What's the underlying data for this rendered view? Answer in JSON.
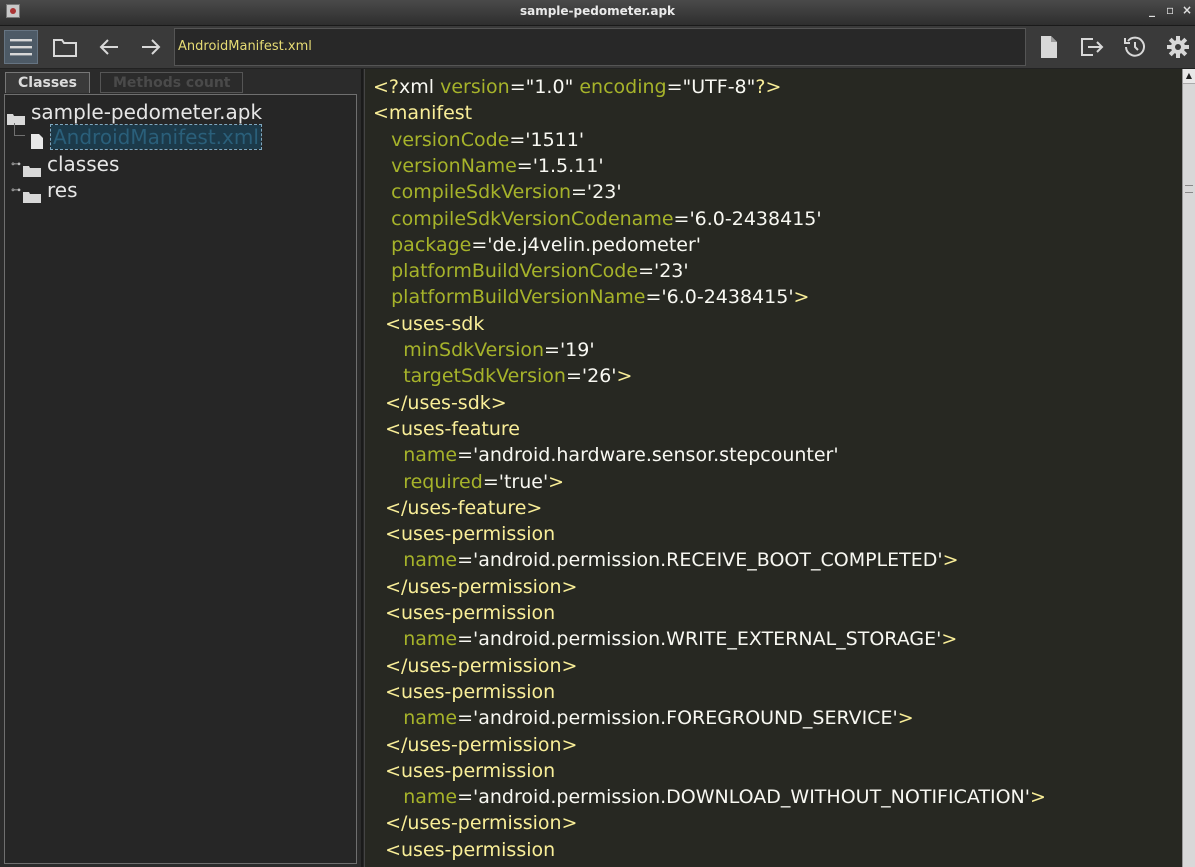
{
  "window": {
    "title": "sample-pedometer.apk",
    "controls": {
      "minimize": "_",
      "maximize": "▫",
      "close": "×"
    }
  },
  "toolbar": {
    "menu_icon": "hamburger-menu-icon",
    "path": "AndroidManifest.xml",
    "icons": [
      "open-folder-icon",
      "back-arrow-icon",
      "forward-arrow-icon",
      "file-icon",
      "export-icon",
      "history-icon",
      "gear-icon"
    ]
  },
  "tabs": {
    "classes": "Classes",
    "methods_count": "Methods count"
  },
  "tree": {
    "root": "sample-pedometer.apk",
    "items": [
      {
        "label": "AndroidManifest.xml",
        "icon": "file-icon",
        "selected": true
      },
      {
        "label": "classes",
        "icon": "folder-icon",
        "expandable": true
      },
      {
        "label": "res",
        "icon": "folder-icon",
        "expandable": true
      }
    ]
  },
  "editor": {
    "lines": [
      [
        [
          "pi",
          "<?"
        ],
        [
          "str",
          "xml "
        ],
        [
          "attr",
          "version"
        ],
        [
          "str",
          "=\"1.0\" "
        ],
        [
          "attr",
          "encoding"
        ],
        [
          "str",
          "=\"UTF-8\""
        ],
        [
          "pi",
          "?>"
        ]
      ],
      [
        [
          "tag",
          "<manifest"
        ]
      ],
      [
        [
          "str",
          "   "
        ],
        [
          "attr",
          "versionCode"
        ],
        [
          "str",
          "='1511'"
        ]
      ],
      [
        [
          "str",
          "   "
        ],
        [
          "attr",
          "versionName"
        ],
        [
          "str",
          "='1.5.11'"
        ]
      ],
      [
        [
          "str",
          "   "
        ],
        [
          "attr",
          "compileSdkVersion"
        ],
        [
          "str",
          "='23'"
        ]
      ],
      [
        [
          "str",
          "   "
        ],
        [
          "attr",
          "compileSdkVersionCodename"
        ],
        [
          "str",
          "='6.0-2438415'"
        ]
      ],
      [
        [
          "str",
          "   "
        ],
        [
          "attr",
          "package"
        ],
        [
          "str",
          "='de.j4velin.pedometer'"
        ]
      ],
      [
        [
          "str",
          "   "
        ],
        [
          "attr",
          "platformBuildVersionCode"
        ],
        [
          "str",
          "='23'"
        ]
      ],
      [
        [
          "str",
          "   "
        ],
        [
          "attr",
          "platformBuildVersionName"
        ],
        [
          "str",
          "='6.0-2438415'"
        ],
        [
          "tag",
          ">"
        ]
      ],
      [
        [
          "str",
          "  "
        ],
        [
          "tag",
          "<uses-sdk"
        ]
      ],
      [
        [
          "str",
          "     "
        ],
        [
          "attr",
          "minSdkVersion"
        ],
        [
          "str",
          "='19'"
        ]
      ],
      [
        [
          "str",
          "     "
        ],
        [
          "attr",
          "targetSdkVersion"
        ],
        [
          "str",
          "='26'"
        ],
        [
          "tag",
          ">"
        ]
      ],
      [
        [
          "str",
          "  "
        ],
        [
          "tag",
          "</uses-sdk>"
        ]
      ],
      [
        [
          "str",
          "  "
        ],
        [
          "tag",
          "<uses-feature"
        ]
      ],
      [
        [
          "str",
          "     "
        ],
        [
          "attr",
          "name"
        ],
        [
          "str",
          "='android.hardware.sensor.stepcounter'"
        ]
      ],
      [
        [
          "str",
          "     "
        ],
        [
          "attr",
          "required"
        ],
        [
          "str",
          "='true'"
        ],
        [
          "tag",
          ">"
        ]
      ],
      [
        [
          "str",
          "  "
        ],
        [
          "tag",
          "</uses-feature>"
        ]
      ],
      [
        [
          "str",
          "  "
        ],
        [
          "tag",
          "<uses-permission"
        ]
      ],
      [
        [
          "str",
          "     "
        ],
        [
          "attr",
          "name"
        ],
        [
          "str",
          "='android.permission.RECEIVE_BOOT_COMPLETED'"
        ],
        [
          "tag",
          ">"
        ]
      ],
      [
        [
          "str",
          "  "
        ],
        [
          "tag",
          "</uses-permission>"
        ]
      ],
      [
        [
          "str",
          "  "
        ],
        [
          "tag",
          "<uses-permission"
        ]
      ],
      [
        [
          "str",
          "     "
        ],
        [
          "attr",
          "name"
        ],
        [
          "str",
          "='android.permission.WRITE_EXTERNAL_STORAGE'"
        ],
        [
          "tag",
          ">"
        ]
      ],
      [
        [
          "str",
          "  "
        ],
        [
          "tag",
          "</uses-permission>"
        ]
      ],
      [
        [
          "str",
          "  "
        ],
        [
          "tag",
          "<uses-permission"
        ]
      ],
      [
        [
          "str",
          "     "
        ],
        [
          "attr",
          "name"
        ],
        [
          "str",
          "='android.permission.FOREGROUND_SERVICE'"
        ],
        [
          "tag",
          ">"
        ]
      ],
      [
        [
          "str",
          "  "
        ],
        [
          "tag",
          "</uses-permission>"
        ]
      ],
      [
        [
          "str",
          "  "
        ],
        [
          "tag",
          "<uses-permission"
        ]
      ],
      [
        [
          "str",
          "     "
        ],
        [
          "attr",
          "name"
        ],
        [
          "str",
          "='android.permission.DOWNLOAD_WITHOUT_NOTIFICATION'"
        ],
        [
          "tag",
          ">"
        ]
      ],
      [
        [
          "str",
          "  "
        ],
        [
          "tag",
          "</uses-permission>"
        ]
      ],
      [
        [
          "str",
          "  "
        ],
        [
          "tag",
          "<uses-permission"
        ]
      ]
    ]
  }
}
